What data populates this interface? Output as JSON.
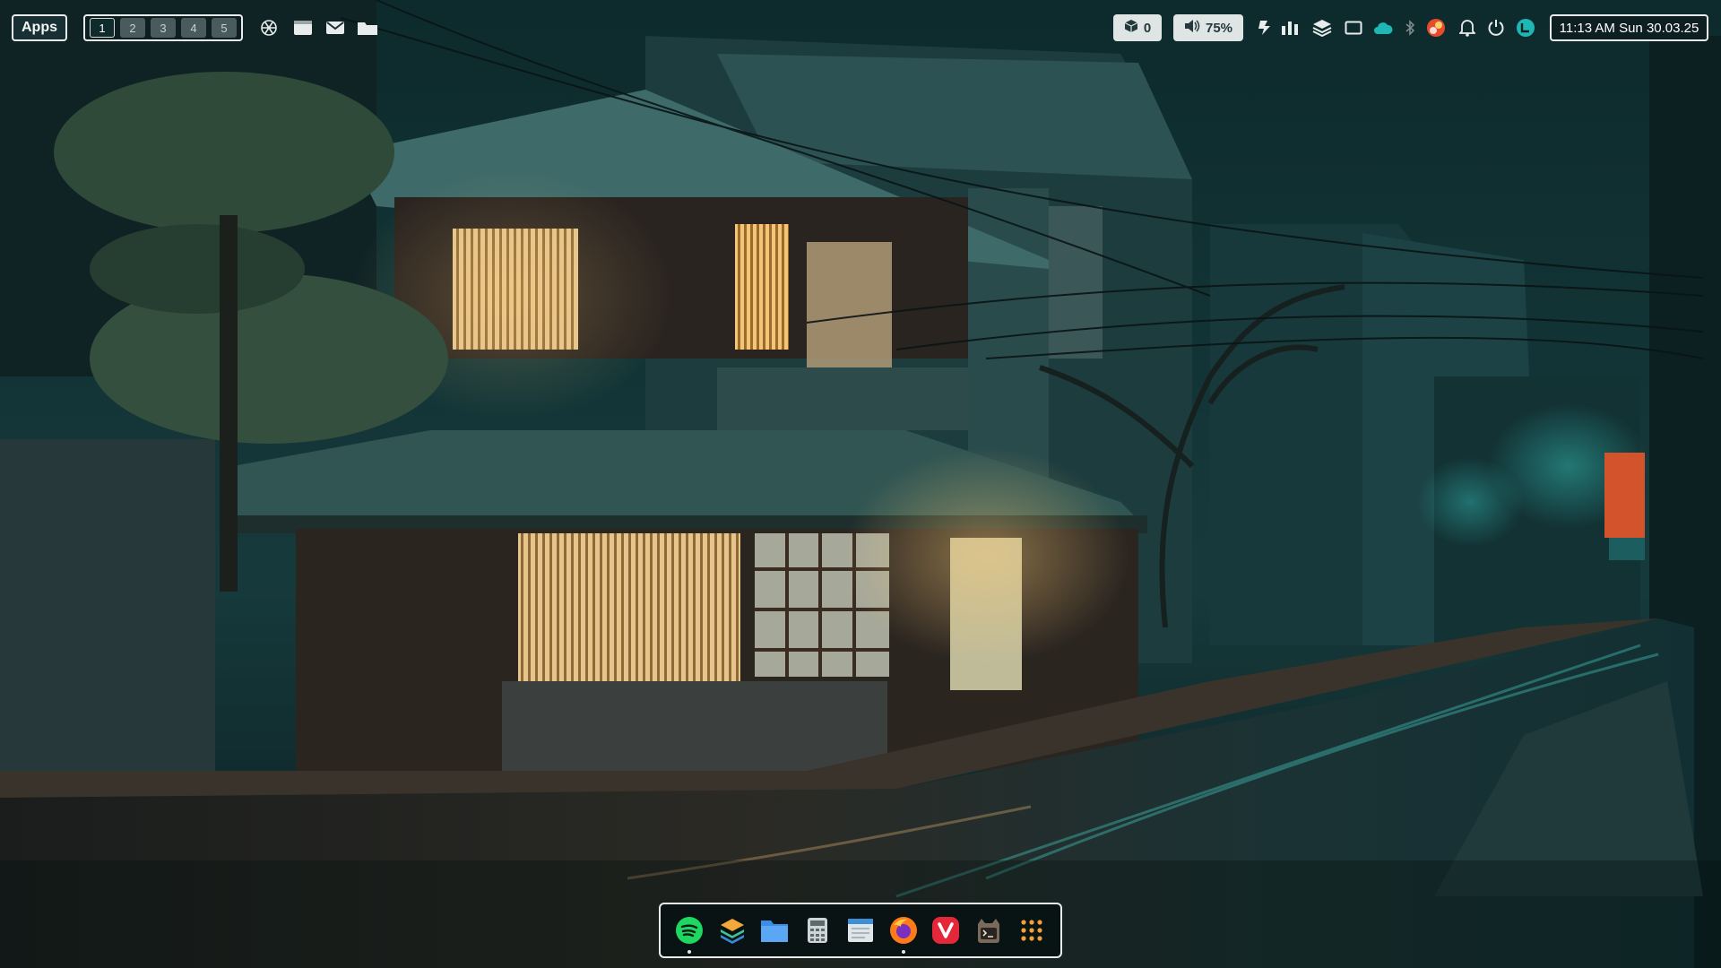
{
  "colors": {
    "accent": "#e8ecec",
    "bar_bg": "#0e1f22",
    "pill_bg": "#dfe4e4",
    "teal": "#1fb6b6"
  },
  "topbar": {
    "apps_label": "Apps",
    "workspaces": [
      "1",
      "2",
      "3",
      "4",
      "5"
    ],
    "active_workspace": "1",
    "launchers": [
      {
        "icon": "openai-icon"
      },
      {
        "icon": "window-icon"
      },
      {
        "icon": "mail-icon"
      },
      {
        "icon": "folder-icon"
      }
    ],
    "updates_count": "0",
    "volume_label": "75%",
    "tray_icons": [
      "run-icon",
      "equalizer-icon",
      "layers-icon",
      "screen-icon",
      "cloud-icon",
      "bluetooth-icon",
      "avatar-icon",
      "bell-icon",
      "power-icon",
      "user-badge-icon"
    ],
    "clock_text": "11:13 AM Sun 30.03.25"
  },
  "dock": {
    "items": [
      {
        "icon": "spotify-icon",
        "running": true
      },
      {
        "icon": "stack-icon",
        "running": false
      },
      {
        "icon": "file-manager-icon",
        "running": false
      },
      {
        "icon": "calculator-icon",
        "running": false
      },
      {
        "icon": "text-editor-icon",
        "running": false
      },
      {
        "icon": "firefox-icon",
        "running": true
      },
      {
        "icon": "vivaldi-icon",
        "running": false
      },
      {
        "icon": "terminal-icon",
        "running": false
      },
      {
        "icon": "app-grid-icon",
        "running": false
      }
    ]
  }
}
